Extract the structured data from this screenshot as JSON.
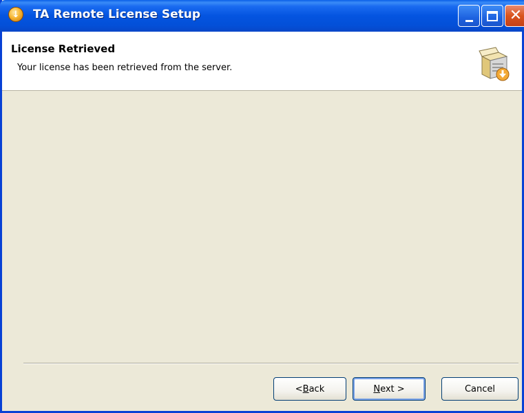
{
  "window": {
    "title": "TA Remote License Setup",
    "accent_color": "#0454e0",
    "close_color": "#d9541c"
  },
  "titlebar_buttons": {
    "minimize_icon": "minimize-icon",
    "maximize_icon": "maximize-icon",
    "close_icon": "close-icon",
    "close_glyph": "✕"
  },
  "header": {
    "title": "License Retrieved",
    "subtitle": "Your license has been retrieved from the server.",
    "icon": "license-box-download-icon"
  },
  "buttons": {
    "back_prefix": "< ",
    "back_access": "B",
    "back_rest": "ack",
    "next_access": "N",
    "next_rest": "ext >",
    "cancel": "Cancel"
  }
}
